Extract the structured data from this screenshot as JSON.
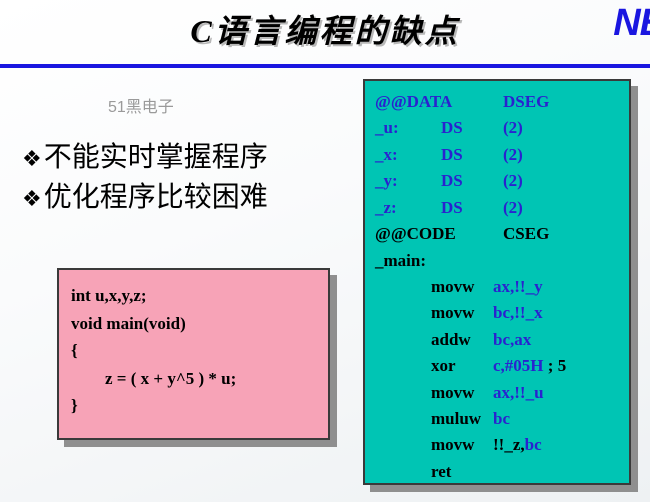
{
  "slide": {
    "title": "C语言编程的缺点",
    "logo": "NE",
    "watermark": "51黑电子",
    "accent_blue": "#1a16e0",
    "teal_bg": "#00c5b4",
    "pink_bg": "#f7a3b7",
    "code_blue": "#2a22cf",
    "shadow_gray": "#8f8f8f"
  },
  "bullets": {
    "marker": "❖",
    "items": [
      {
        "text": "不能实时掌握程序"
      },
      {
        "text": "优化程序比较困难"
      }
    ]
  },
  "c_code": {
    "lines": [
      {
        "text": "int u,x,y,z;",
        "indent": false
      },
      {
        "text": "void main(void)",
        "indent": false
      },
      {
        "text": "{",
        "indent": false
      },
      {
        "text": "z = ( x + y^5 ) * u;",
        "indent": true
      },
      {
        "text": "}",
        "indent": false
      }
    ]
  },
  "asm_code": {
    "lines": [
      {
        "c1": "@@DATA",
        "c2": "",
        "c3": "DSEG",
        "c1_color": "blue",
        "c2_color": "blue",
        "c3_color": "blue",
        "indent": false
      },
      {
        "c1": "_u:",
        "c2": "DS",
        "c3": "(2)",
        "c1_color": "blue",
        "c2_color": "blue",
        "c3_color": "blue",
        "indent": false
      },
      {
        "c1": "_x:",
        "c2": "DS",
        "c3": "(2)",
        "c1_color": "blue",
        "c2_color": "blue",
        "c3_color": "blue",
        "indent": false
      },
      {
        "c1": "_y:",
        "c2": "DS",
        "c3": "(2)",
        "c1_color": "blue",
        "c2_color": "blue",
        "c3_color": "blue",
        "indent": false
      },
      {
        "c1": "_z:",
        "c2": "DS",
        "c3": "(2)",
        "c1_color": "blue",
        "c2_color": "blue",
        "c3_color": "blue",
        "indent": false
      },
      {
        "c1": "@@CODE",
        "c2": "",
        "c3": "CSEG",
        "c1_color": "black",
        "c2_color": "black",
        "c3_color": "black",
        "indent": false
      },
      {
        "c1": "_main:",
        "c2": "",
        "c3": "",
        "c1_color": "black",
        "c2_color": "black",
        "c3_color": "black",
        "indent": false
      },
      {
        "c1": "",
        "c2": "movw",
        "c3": "ax,!!_y",
        "c1_color": "black",
        "c2_color": "black",
        "c3_color": "blue",
        "indent": true
      },
      {
        "c1": "",
        "c2": "movw",
        "c3": "bc,!!_x",
        "c1_color": "black",
        "c2_color": "black",
        "c3_color": "blue",
        "indent": true
      },
      {
        "c1": "",
        "c2": "addw",
        "c3": "bc,ax",
        "c1_color": "black",
        "c2_color": "black",
        "c3_color": "blue",
        "indent": true
      },
      {
        "c1": "",
        "c2": "xor",
        "c3": "c,#05H ; 5",
        "c1_color": "black",
        "c2_color": "black",
        "c3_color": "mixed",
        "indent": true
      },
      {
        "c1": "",
        "c2": "movw",
        "c3": "ax,!!_u",
        "c1_color": "black",
        "c2_color": "black",
        "c3_color": "blue",
        "indent": true
      },
      {
        "c1": "",
        "c2": "muluw",
        "c3": "bc",
        "c1_color": "black",
        "c2_color": "black",
        "c3_color": "blue",
        "indent": true
      },
      {
        "c1": "",
        "c2": "movw",
        "c3": "!!_z,bc",
        "c1_color": "black",
        "c2_color": "black",
        "c3_color": "mixed2",
        "indent": true
      },
      {
        "c1": "",
        "c2": "ret",
        "c3": "",
        "c1_color": "black",
        "c2_color": "black",
        "c3_color": "black",
        "indent": true
      }
    ]
  }
}
